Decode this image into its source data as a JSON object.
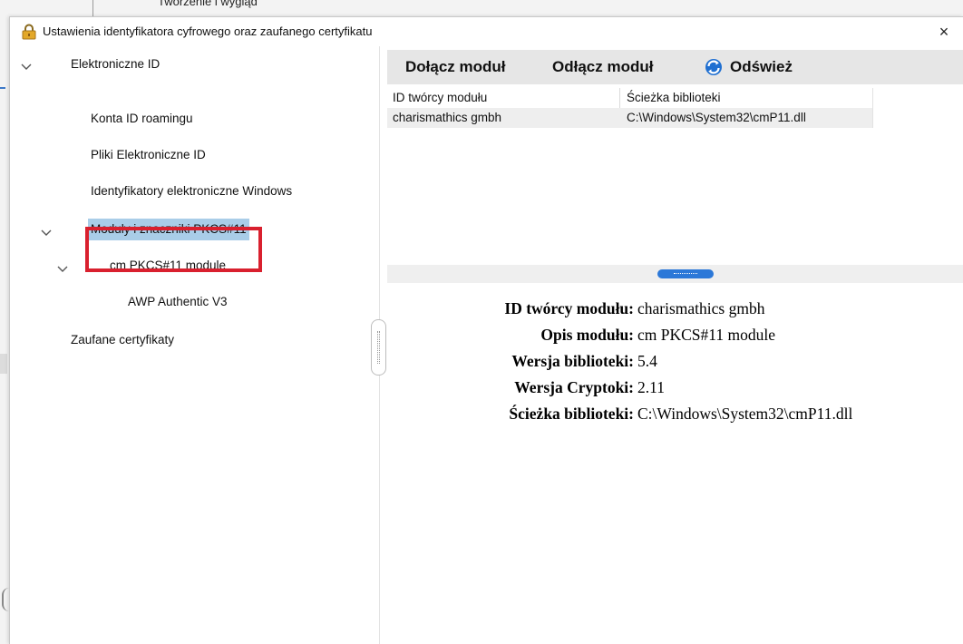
{
  "background": {
    "top_text": "Tworzenie i wygląd"
  },
  "dialog": {
    "title": "Ustawienia identyfikatora cyfrowego oraz zaufanego certyfikatu",
    "close": "×"
  },
  "tree": {
    "items": [
      {
        "label": "Elektroniczne ID"
      },
      {
        "label": "Konta ID roamingu"
      },
      {
        "label": "Pliki Elektroniczne ID"
      },
      {
        "label": "Identyfikatory elektroniczne Windows"
      },
      {
        "label": "Moduły i znaczniki PKCS#11"
      },
      {
        "label": "cm PKCS#11 module"
      },
      {
        "label": "AWP Authentic V3"
      },
      {
        "label": "Zaufane certyfikaty"
      }
    ]
  },
  "toolbar": {
    "attach": "Dołącz moduł",
    "detach": "Odłącz moduł",
    "refresh": "Odśwież"
  },
  "table": {
    "headers": [
      "ID twórcy modułu",
      "Ścieżka biblioteki"
    ],
    "rows": [
      [
        "charismathics gmbh",
        "C:\\Windows\\System32\\cmP11.dll"
      ]
    ]
  },
  "details": [
    {
      "label": "ID twórcy modułu:",
      "value": "charismathics gmbh"
    },
    {
      "label": "Opis modułu:",
      "value": "cm PKCS#11 module"
    },
    {
      "label": "Wersja biblioteki:",
      "value": "5.4"
    },
    {
      "label": "Wersja Cryptoki:",
      "value": "2.11"
    },
    {
      "label": "Ścieżka biblioteki:",
      "value": "C:\\Windows\\System32\\cmP11.dll"
    }
  ],
  "colors": {
    "selection": "#a9cde8",
    "highlight_box": "#d9202e",
    "splitter_handle": "#2c78d8",
    "toolbar_bg": "#e6e6e6"
  },
  "icons": {
    "title": "lock-icon",
    "refresh": "refresh-icon",
    "close": "close-icon",
    "expand": "chevron-down-icon"
  }
}
